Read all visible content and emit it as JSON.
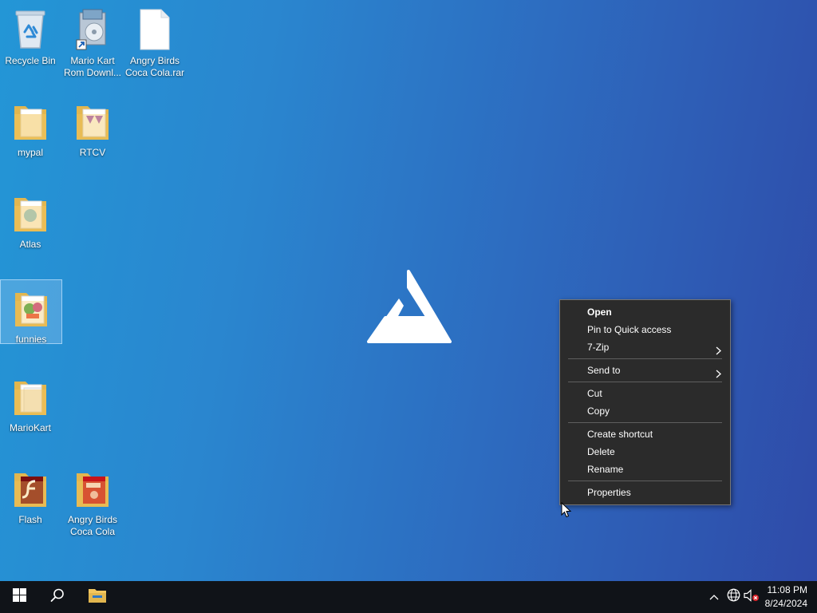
{
  "desktop": {
    "icons": [
      {
        "label": "Recycle Bin",
        "icon": "recycle-bin-icon"
      },
      {
        "label": "Mario Kart Rom Downl...",
        "icon": "installer-shortcut-icon"
      },
      {
        "label": "Angry Birds Coca Cola.rar",
        "icon": "blank-file-icon"
      },
      {
        "label": "mypal",
        "icon": "folder-icon"
      },
      {
        "label": "RTCV",
        "icon": "folder-icon"
      },
      {
        "label": "Atlas",
        "icon": "folder-icon"
      },
      {
        "label": "funnies",
        "icon": "folder-icon",
        "selected": true
      },
      {
        "label": "MarioKart",
        "icon": "folder-icon"
      },
      {
        "label": "Flash",
        "icon": "folder-icon"
      },
      {
        "label": "Angry Birds Coca Cola",
        "icon": "folder-icon"
      }
    ]
  },
  "context_menu": {
    "items": [
      {
        "label": "Open"
      },
      {
        "label": "Pin to Quick access"
      },
      {
        "label": "7-Zip",
        "submenu": true
      },
      {
        "label": "Send to",
        "submenu": true
      },
      {
        "label": "Cut"
      },
      {
        "label": "Copy"
      },
      {
        "label": "Create shortcut"
      },
      {
        "label": "Delete"
      },
      {
        "label": "Rename"
      },
      {
        "label": "Properties"
      }
    ]
  },
  "taskbar": {
    "buttons": [
      "start-icon",
      "search-icon",
      "file-explorer-icon"
    ],
    "tray": [
      "chevron-up-icon",
      "network-globe-icon",
      "volume-muted-icon"
    ],
    "clock": {
      "time": "11:08 PM",
      "date": "8/24/2024"
    }
  },
  "colors": {
    "menu_bg": "#2b2b2b",
    "taskbar_bg": "#101318",
    "folder": "#f3c65e"
  }
}
